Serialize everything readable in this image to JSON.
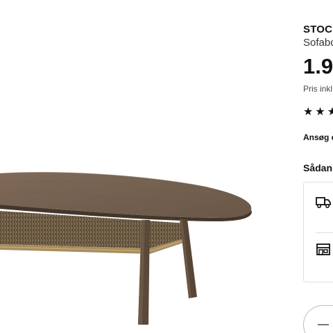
{
  "product": {
    "name": "STOCKHOLM",
    "subtitle": "Sofabord",
    "price": "1.9",
    "price_note": "Pris inkl",
    "rating_stars": "★★★",
    "rating_icon": "star-icon",
    "finance_link": "Ansøg o"
  },
  "delivery": {
    "heading": "Sådan",
    "options": [
      {
        "icon": "truck-icon"
      },
      {
        "icon": "store-icon"
      }
    ]
  },
  "quantity": {
    "decrease_icon": "minus-icon"
  },
  "colors": {
    "text": "#111111",
    "border": "#dfdfdf",
    "wood_top": "#7b6655",
    "wood_dark": "#4f4034",
    "rattan": "#8c7a5e"
  }
}
